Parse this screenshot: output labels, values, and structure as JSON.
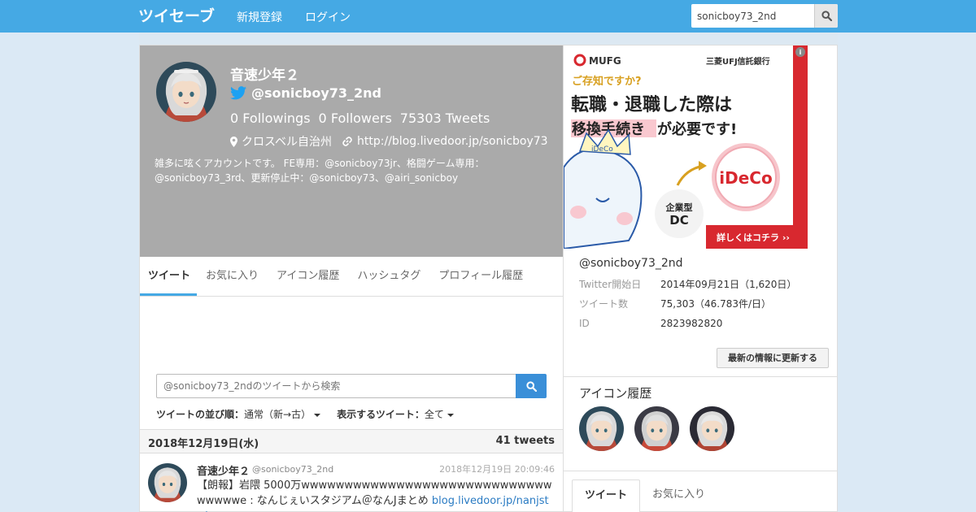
{
  "navbar": {
    "logo_text": "ツイセーブ",
    "register": "新規登録",
    "login": "ログイン",
    "search_value": "sonicboy73_2nd"
  },
  "profile": {
    "name": "音速少年２",
    "handle": "@sonicboy73_2nd",
    "followings_count": "0",
    "followings_label": "Followings",
    "followers_count": "0",
    "followers_label": "Followers",
    "tweets_count": "75303",
    "tweets_label": "Tweets",
    "location": "クロスベル自治州",
    "url": "http://blog.livedoor.jp/sonicboy73",
    "bio": "雑多に呟くアカウントです。 FE専用：@sonicboy73jr、格闘ゲーム専用：@sonicboy73_3rd、更新停止中：@sonicboy73、@airi_sonicboy"
  },
  "tabs": [
    {
      "label": "ツイート",
      "active": true
    },
    {
      "label": "お気に入り",
      "active": false
    },
    {
      "label": "アイコン履歴",
      "active": false
    },
    {
      "label": "ハッシュタグ",
      "active": false
    },
    {
      "label": "プロフィール履歴",
      "active": false
    }
  ],
  "tweet_search": {
    "placeholder": "@sonicboy73_2ndのツイートから検索"
  },
  "sort": {
    "order_label": "ツイートの並び順：",
    "order_value": "通常（新→古）",
    "show_label": "表示するツイート：",
    "show_value": "全て"
  },
  "date_bar": {
    "date": "2018年12月19日(水)",
    "count": "41 tweets"
  },
  "tweet": {
    "name": "音速少年２",
    "handle": "@sonicboy73_2nd",
    "time": "2018年12月19日 20:09:46",
    "text": "【朗報】岩隈 5000万wwwwwwwwwwwwwwwwwwwwwwwwwwwwwwwwwwe : なんじぇいスタジアム＠なんJまとめ ",
    "link": "blog.livedoor.jp/nanjstu/a"
  },
  "ad": {
    "bank_logo": "MUFG",
    "bank_name": "三菱UFJ信託銀行",
    "headline1": "ご存知ですか?",
    "headline2": "転職・退職した際は",
    "headline3": "移換手続き",
    "headline3b": "が必要です!",
    "badge_dc_line1": "企業型",
    "badge_dc_line2": "DC",
    "badge_ideco": "iDeCo",
    "cta": "詳しくはコチラ ››",
    "mascot_text": "iDeCo",
    "info_icon": "i"
  },
  "account": {
    "handle": "@sonicboy73_2nd",
    "rows": [
      {
        "k": "Twitter開始日",
        "v": "2014年09月21日（1,620日）"
      },
      {
        "k": "ツイート数",
        "v": "75,303（46.783件/日）"
      },
      {
        "k": "ID",
        "v": "2823982820"
      }
    ],
    "update_button": "最新の情報に更新する"
  },
  "icon_history": {
    "title": "アイコン履歴"
  },
  "right_tabs": [
    {
      "label": "ツイート",
      "active": true
    },
    {
      "label": "お気に入り",
      "active": false
    }
  ],
  "colors": {
    "navbar": "#45a9e4",
    "accent": "#3a8fd8",
    "ad_red": "#d8282f"
  }
}
